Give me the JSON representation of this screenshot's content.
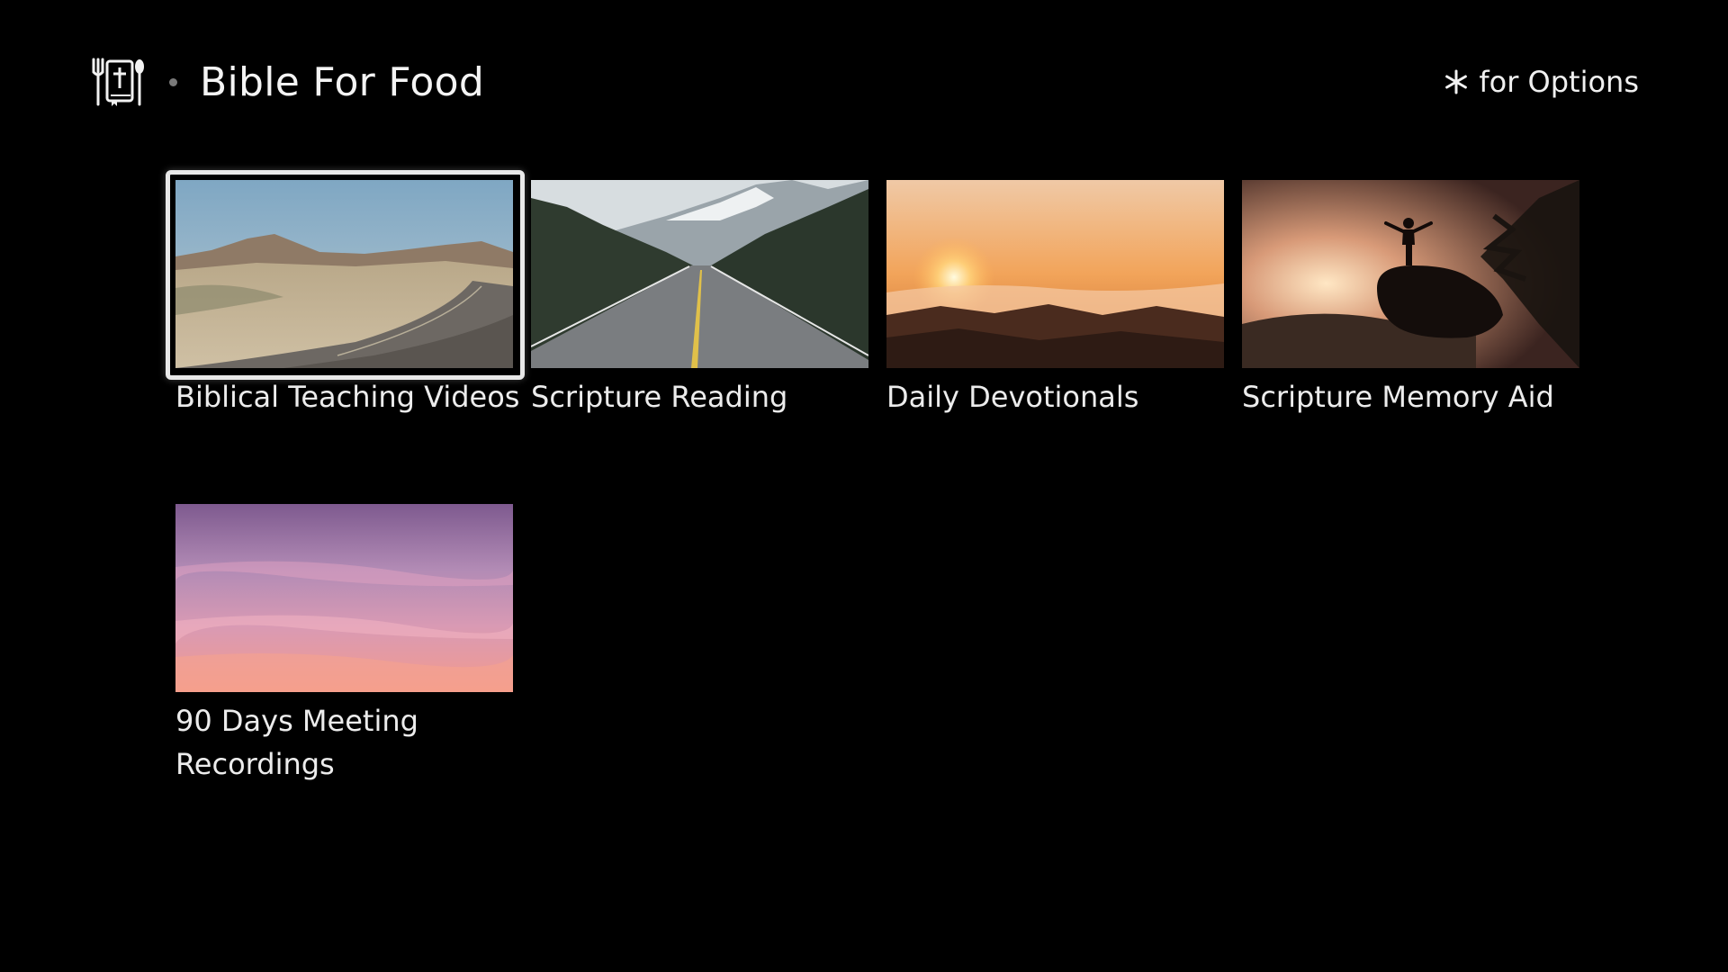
{
  "header": {
    "app_title": "Bible For Food",
    "logo_icon": "bible-fork-spoon-icon",
    "options_icon": "asterisk-icon",
    "options_text": "for Options"
  },
  "tiles": [
    {
      "label": "Biblical Teaching Videos",
      "image": "desert-road",
      "focused": true
    },
    {
      "label": "Scripture Reading",
      "image": "mountain-highway",
      "focused": false
    },
    {
      "label": "Daily Devotionals",
      "image": "sunrise-above-clouds",
      "focused": false
    },
    {
      "label": "Scripture Memory Aid",
      "image": "silhouette-on-rock",
      "focused": false
    },
    {
      "label": "90 Days Meeting Recordings",
      "image": "pink-sky",
      "focused": false
    }
  ],
  "colors": {
    "background": "#000000",
    "text": "#f2f2f2",
    "focus_ring": "#e8e8e8"
  }
}
